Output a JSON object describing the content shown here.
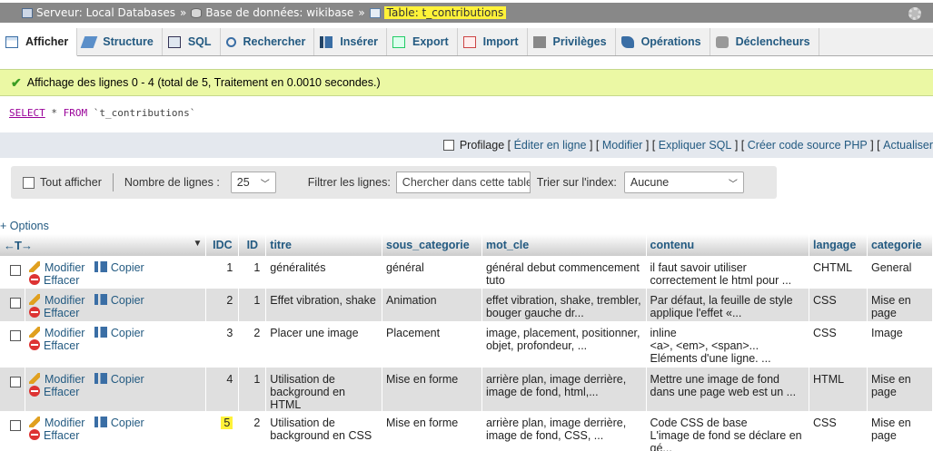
{
  "breadcrumb": {
    "server": "Serveur: Local Databases",
    "database": "Base de données: wikibase",
    "table": "Table: t_contributions",
    "separator": "»"
  },
  "tabs": [
    {
      "label": "Afficher",
      "icon": "browse-icon",
      "active": true
    },
    {
      "label": "Structure",
      "icon": "structure-icon"
    },
    {
      "label": "SQL",
      "icon": "sql-icon"
    },
    {
      "label": "Rechercher",
      "icon": "search-icon"
    },
    {
      "label": "Insérer",
      "icon": "insert-icon"
    },
    {
      "label": "Export",
      "icon": "export-icon"
    },
    {
      "label": "Import",
      "icon": "import-icon"
    },
    {
      "label": "Privilèges",
      "icon": "privileges-icon"
    },
    {
      "label": "Opérations",
      "icon": "operations-icon"
    },
    {
      "label": "Déclencheurs",
      "icon": "triggers-icon"
    }
  ],
  "success_message": "Affichage des lignes 0 - 4 (total de 5, Traitement en 0.0010 secondes.)",
  "sql": {
    "select": "SELECT",
    "rest1": " * ",
    "from": "FROM",
    "table": " `t_contributions`"
  },
  "query_links": {
    "profilage": "Profilage",
    "edit_inline": "Éditer en ligne",
    "edit": "Modifier",
    "explain": "Expliquer SQL",
    "php": "Créer code source PHP",
    "refresh": "Actualiser"
  },
  "navigation": {
    "show_all": "Tout afficher",
    "rows_label": "Nombre de lignes :",
    "rows_value": "25",
    "filter_label": "Filtrer les lignes:",
    "filter_placeholder": "Chercher dans cette table",
    "sort_label": "Trier sur l'index:",
    "sort_value": "Aucune"
  },
  "options_label": "+ Options",
  "table": {
    "columns": [
      "IDC",
      "ID",
      "titre",
      "sous_categorie",
      "mot_cle",
      "contenu",
      "langage",
      "categorie"
    ],
    "actions": {
      "edit": "Modifier",
      "copy": "Copier",
      "delete": "Effacer"
    },
    "rows": [
      {
        "idc": "1",
        "id": "1",
        "titre": "généralités",
        "sous_categorie": "général",
        "mot_cle": "général debut commencement tuto",
        "contenu": "il faut savoir utiliser correctement le html pour ...",
        "langage": "CHTML",
        "categorie": "General"
      },
      {
        "idc": "2",
        "id": "1",
        "titre": "Effet vibration, shake",
        "sous_categorie": "Animation",
        "mot_cle": "effet vibration, shake, trembler, bouger gauche dr...",
        "contenu": "Par défaut, la feuille de style applique l'effet «...",
        "langage": "CSS",
        "categorie": "Mise en page"
      },
      {
        "idc": "3",
        "id": "2",
        "titre": "Placer une image",
        "sous_categorie": "Placement",
        "mot_cle": "image, placement, positionner, objet, profondeur, ...",
        "contenu": "inline\n<a>, <em>, <span>...\nEléments d'une ligne. ...",
        "langage": "CSS",
        "categorie": "Image"
      },
      {
        "idc": "4",
        "id": "1",
        "titre": "Utilisation de background en HTML",
        "sous_categorie": "Mise en forme",
        "mot_cle": "arrière plan, image derrière, image de fond, html,...",
        "contenu": "Mettre une image de fond dans une page web est un ...",
        "langage": "HTML",
        "categorie": "Mise en page"
      },
      {
        "idc": "5",
        "id": "2",
        "titre": "Utilisation de background en CSS",
        "sous_categorie": "Mise en forme",
        "mot_cle": "arrière plan, image derrière, image de fond, CSS, ...",
        "contenu": "Code CSS de base\nL'image de fond se déclare en gé...",
        "langage": "CSS",
        "categorie": "Mise en page"
      }
    ]
  },
  "colors": {
    "link": "#235a81",
    "highlight": "#fff239",
    "success_bg": "#ebf8a4",
    "row_even": "#dfdfdf"
  }
}
